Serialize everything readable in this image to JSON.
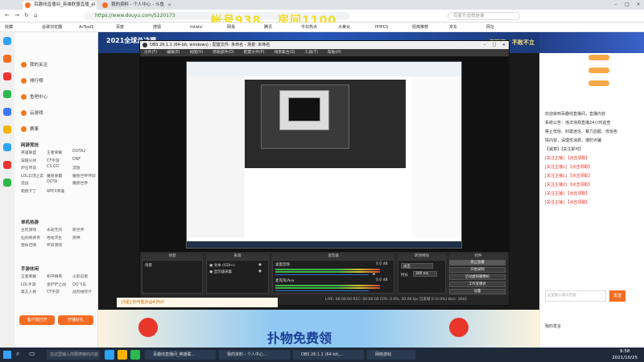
{
  "browser": {
    "tabs": [
      {
        "title": "百趣线直播间_英雄联盟直播_斗",
        "active": true
      },
      {
        "title": "我的资料 - 个人中心 - 斗鱼",
        "active": false
      }
    ],
    "url": "https://www.douyu.com/5220173",
    "search_placeholder": "百家乐追我是谁",
    "overlay_text": "帐号938、 房间1100",
    "bookmarks": [
      "收藏",
      "谷歌浏览器",
      "ArToolS",
      "百度",
      "搜狐",
      "mtalvi",
      "网易",
      "腾讯",
      "今日热点",
      "大美女",
      "PHPCh",
      "经典推荐",
      "京东",
      "网址"
    ]
  },
  "douyu": {
    "nav": [
      {
        "label": "我的关注"
      },
      {
        "label": "排行榜"
      },
      {
        "label": "鱼吧中心"
      },
      {
        "label": "云游戏"
      },
      {
        "label": "赛事"
      }
    ],
    "sections": [
      {
        "title": "网游竞技",
        "items": [
          "英雄联盟",
          "王者荣耀",
          "DOTA2",
          "穿越火线",
          "CF手游",
          "DNF",
          "炉石传说",
          "CS:GO",
          "流放",
          "LOL云顶之弈",
          "魔兽争霸",
          "魔兽世界怀旧",
          "逆战",
          "DOTA",
          "魔兽世界",
          "跑跑卡丁",
          "APEX英雄"
        ]
      },
      {
        "title": "单机热游",
        "items": [
          "主机游戏",
          "永劫无间",
          "新世界",
          "仙剑奇侠传",
          "绝地求生",
          "原神",
          "使命召唤",
          "怀旧游戏"
        ]
      },
      {
        "title": "手游休闲",
        "items": [
          "王者荣耀",
          "和平精英",
          "火影忍者",
          "LOL手游",
          "金铲铲之战",
          "QQ飞车",
          "第五人格",
          "CF手游",
          "战双帕弥什"
        ]
      }
    ],
    "sidebar_buttons": [
      "客户端打开",
      "开播好礼"
    ],
    "banner_title": "2021全球总决赛",
    "banner_right": "竞猜赢 / 不败不立",
    "room_info": "[5星] 你可能办@4350!",
    "bottom_banner": "扑物免费领",
    "chat": {
      "lines": [
        "欢迎来到百趣线直播间，直播内容",
        "系统公告：违法违规直播24小时巡查",
        "禁止低俗、封建迷信、暴力血腥、低俗色",
        "情内容，请理性消费，谨防诈骗",
        "【诚意】【关注即可】",
        "[关注主播] 【点击领取】",
        "[关注主播1] 【点击领取】",
        "[关注主播1] 【点击领取】",
        "[关注主播2] 【点击领取】",
        "[关注主播] 【点击领取】",
        "[关注主播] 【点击领取】"
      ],
      "input_placeholder": "这里输入聊天内容",
      "send_label": "发送",
      "my_fans_label": "我的发言"
    }
  },
  "obs": {
    "title": "OBS 26.1.1 (64-bit, windows) - 配置文件: 未命名 - 场景: 未命名",
    "menu": [
      "文件(F)",
      "编辑(E)",
      "视图(V)",
      "停靠部件(D)",
      "配置文件(P)",
      "场景集合(S)",
      "工具(T)",
      "帮助(H)"
    ],
    "docks": {
      "scenes_header": "场景",
      "scene_item": "场景",
      "sources_header": "来源",
      "sources": [
        "文本 (GDI+)",
        "显示器采集"
      ],
      "mixer_header": "混音器",
      "mixer_channels": [
        {
          "name": "桌面音频",
          "db": "0.0 dB"
        },
        {
          "name": "麦克风/Aux",
          "db": "0.0 dB"
        }
      ],
      "transitions_header": "转场特效",
      "transition_type": "淡出",
      "duration_label": "时长",
      "duration_value": "300 ms",
      "controls_header": "控件",
      "controls": [
        "停止直播",
        "开始录制",
        "启动虚拟摄像机",
        "工作室模式",
        "设置",
        "退出"
      ]
    },
    "status": "LIVE: 00:00:00   REC: 00:00:00   CPU: 0.4%, 30.00 fps   已丢帧 0 (0.0%)   kb/s: 2641"
  },
  "taskbar": {
    "search_placeholder": "在这里输入你要搜索的内容",
    "tasks": [
      "百趣线直播间_英雄联...",
      "我的资料 - 个人中心...",
      "OBS 26.1.1 (64-bit,...",
      "网络游戏"
    ],
    "time": "9:58",
    "date": "2021/10/25"
  },
  "colors": {
    "douyu_orange": "#f46d24",
    "obs_bg": "#2b2b2b",
    "taskbar": "#1e2a3a"
  }
}
